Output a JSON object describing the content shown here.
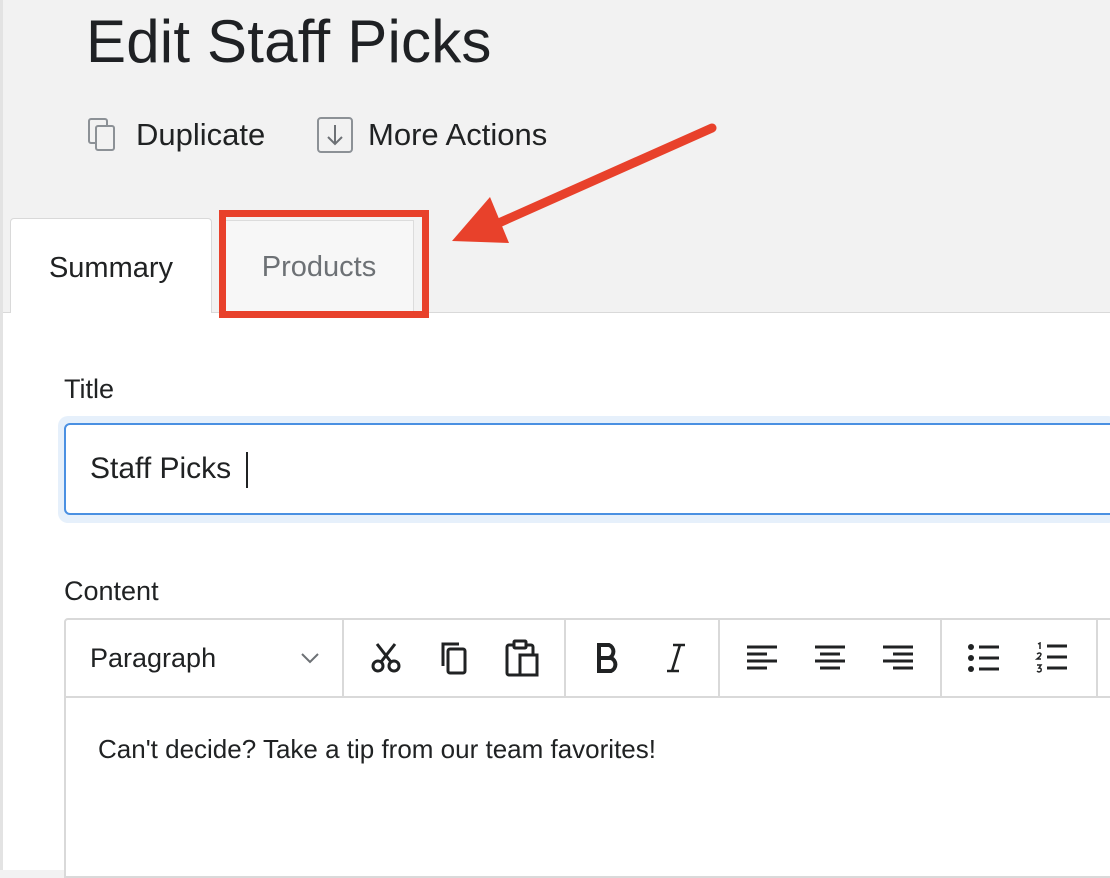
{
  "header": {
    "title": "Edit Staff Picks",
    "actions": [
      {
        "label": "Duplicate",
        "icon": "duplicate-icon"
      },
      {
        "label": "More Actions",
        "icon": "download-arrow-icon"
      }
    ]
  },
  "tabs": [
    {
      "label": "Summary",
      "selected": true
    },
    {
      "label": "Products",
      "selected": false,
      "highlighted": true
    }
  ],
  "form": {
    "title_label": "Title",
    "title_value": "Staff Picks",
    "content_label": "Content",
    "editor": {
      "format_selected": "Paragraph",
      "body_text": "Can't decide? Take a tip from our team favorites!",
      "toolbar_icons": [
        "cut-icon",
        "copy-icon",
        "paste-icon",
        "bold-icon",
        "italic-icon",
        "align-left-icon",
        "align-center-icon",
        "align-right-icon",
        "bullet-list-icon",
        "numbered-list-icon"
      ]
    }
  },
  "colors": {
    "annotation": "#e8412b",
    "focus_border": "#4a90e2",
    "focus_ring": "#e6f0fb",
    "page_background": "#f2f2f2",
    "panel_background": "#ffffff",
    "text": "#202223",
    "muted_text": "#6d7175"
  }
}
